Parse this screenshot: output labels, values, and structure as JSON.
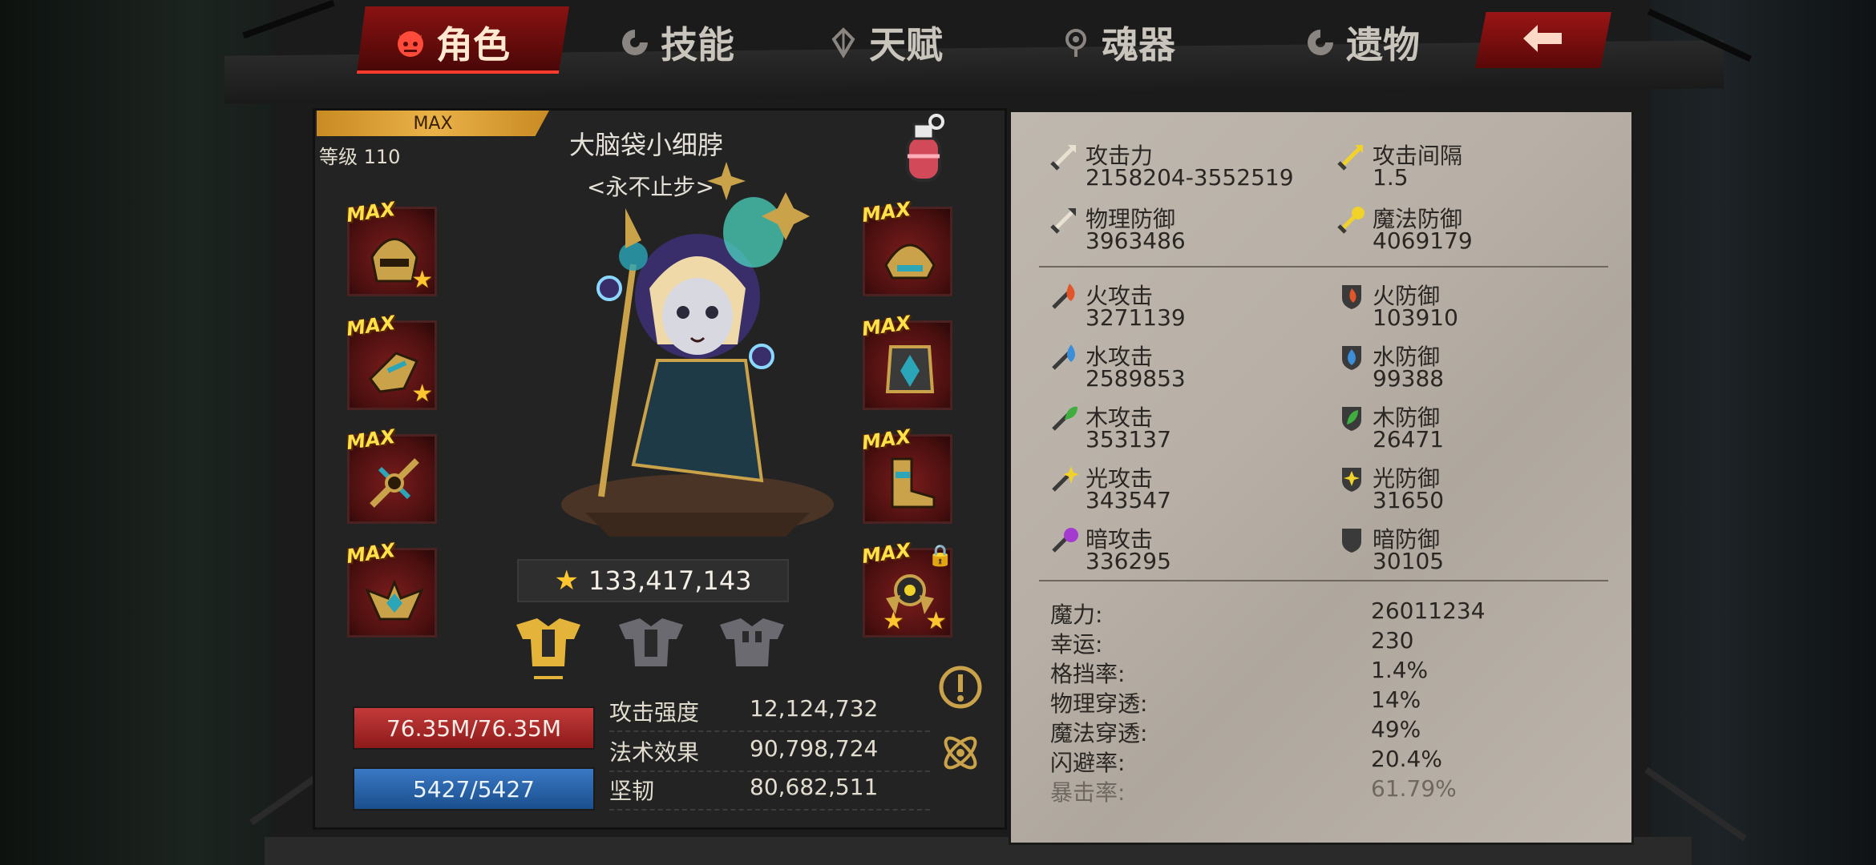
{
  "tabs": [
    {
      "label": "角色",
      "active": true
    },
    {
      "label": "技能",
      "active": false
    },
    {
      "label": "天赋",
      "active": false
    },
    {
      "label": "魂器",
      "active": false
    },
    {
      "label": "遗物",
      "active": false
    }
  ],
  "character": {
    "max_label": "MAX",
    "level_label": "等级 110",
    "name": "大脑袋小细脖",
    "title": "<永不止步>",
    "power": "133,417,143",
    "hp": "76.35M/76.35M",
    "mp": "5427/5427"
  },
  "equipment": {
    "max_tag": "MAX",
    "left": [
      {
        "slot": "helmet",
        "stars": 1
      },
      {
        "slot": "gauntlet",
        "stars": 1
      },
      {
        "slot": "weapon",
        "stars": 0
      },
      {
        "slot": "emblem",
        "stars": 0
      }
    ],
    "right": [
      {
        "slot": "shoulder",
        "stars": 0
      },
      {
        "slot": "chest",
        "stars": 0
      },
      {
        "slot": "boots",
        "stars": 0
      },
      {
        "slot": "crest",
        "stars": 2,
        "locked": true
      }
    ]
  },
  "strength": [
    {
      "label": "攻击强度",
      "value": "12,124,732"
    },
    {
      "label": "法术效果",
      "value": "90,798,724"
    },
    {
      "label": "坚韧",
      "value": "80,682,511"
    }
  ],
  "stats_top": [
    {
      "name": "攻击力",
      "value": "2158204-3552519",
      "icon": "sword-icon"
    },
    {
      "name": "攻击间隔",
      "value": "1.5",
      "icon": "attack-speed-icon"
    },
    {
      "name": "物理防御",
      "value": "3963486",
      "icon": "physical-defense-icon"
    },
    {
      "name": "魔法防御",
      "value": "4069179",
      "icon": "magic-defense-icon"
    }
  ],
  "stats_element": [
    {
      "name": "火攻击",
      "value": "3271139",
      "icon": "fire-attack-icon",
      "color": "#e2552a"
    },
    {
      "name": "火防御",
      "value": "103910",
      "icon": "fire-defense-icon",
      "color": "#e2552a"
    },
    {
      "name": "水攻击",
      "value": "2589853",
      "icon": "water-attack-icon",
      "color": "#3a8fd8"
    },
    {
      "name": "水防御",
      "value": "99388",
      "icon": "water-defense-icon",
      "color": "#3a8fd8"
    },
    {
      "name": "木攻击",
      "value": "353137",
      "icon": "wood-attack-icon",
      "color": "#3fae3f"
    },
    {
      "name": "木防御",
      "value": "26471",
      "icon": "wood-defense-icon",
      "color": "#3fae3f"
    },
    {
      "name": "光攻击",
      "value": "343547",
      "icon": "light-attack-icon",
      "color": "#f1d22a"
    },
    {
      "name": "光防御",
      "value": "31650",
      "icon": "light-defense-icon",
      "color": "#f1d22a"
    },
    {
      "name": "暗攻击",
      "value": "336295",
      "icon": "dark-attack-icon",
      "color": "#a43ad0"
    },
    {
      "name": "暗防御",
      "value": "30105",
      "icon": "dark-defense-icon",
      "color": "#a43ad0"
    }
  ],
  "stats_misc": [
    {
      "label": "魔力:",
      "value": "26011234"
    },
    {
      "label": "幸运:",
      "value": "230"
    },
    {
      "label": "格挡率:",
      "value": "1.4%"
    },
    {
      "label": "物理穿透:",
      "value": "14%"
    },
    {
      "label": "魔法穿透:",
      "value": "49%"
    },
    {
      "label": "闪避率:",
      "value": "20.4%"
    },
    {
      "label": "暴击率:",
      "value": "61.79%"
    }
  ]
}
